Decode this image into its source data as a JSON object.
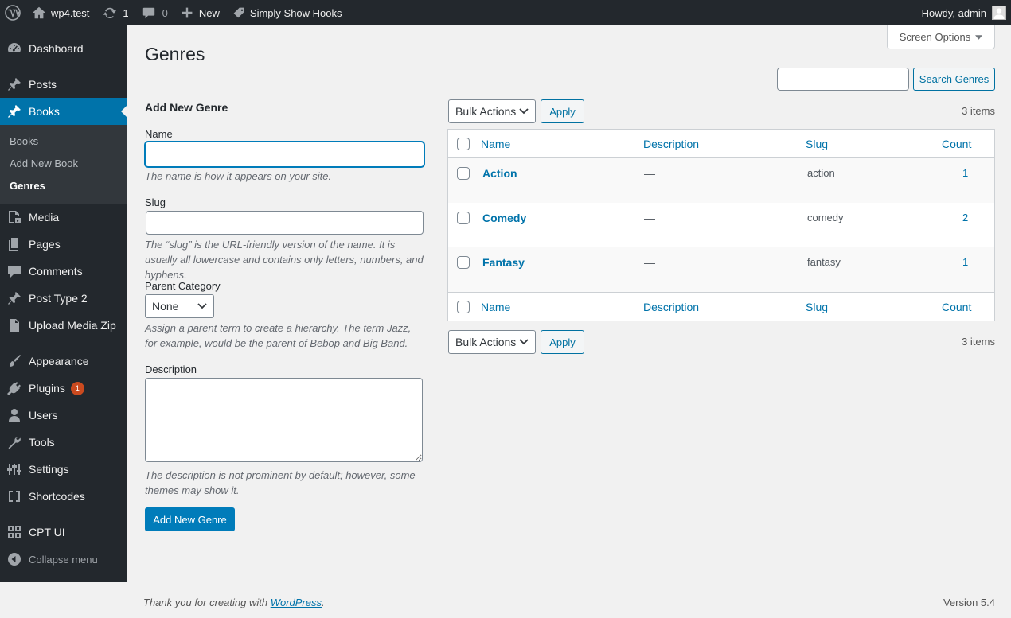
{
  "adminbar": {
    "site_name": "wp4.test",
    "updates_count": "1",
    "comments_count": "0",
    "new_label": "New",
    "plugin_link": "Simply Show Hooks",
    "howdy": "Howdy, admin"
  },
  "sidebar": {
    "items": [
      {
        "label": "Dashboard",
        "icon": "dashboard-icon"
      },
      {
        "label": "Posts",
        "icon": "pin-icon"
      },
      {
        "label": "Books",
        "icon": "pin-icon"
      },
      {
        "label": "Media",
        "icon": "media-icon"
      },
      {
        "label": "Pages",
        "icon": "pages-icon"
      },
      {
        "label": "Comments",
        "icon": "comment-icon"
      },
      {
        "label": "Post Type 2",
        "icon": "pin-icon"
      },
      {
        "label": "Upload Media Zip",
        "icon": "document-icon"
      },
      {
        "label": "Appearance",
        "icon": "brush-icon"
      },
      {
        "label": "Plugins",
        "icon": "plugin-icon",
        "badge": "1"
      },
      {
        "label": "Users",
        "icon": "user-icon"
      },
      {
        "label": "Tools",
        "icon": "wrench-icon"
      },
      {
        "label": "Settings",
        "icon": "settings-icon"
      },
      {
        "label": "Shortcodes",
        "icon": "brackets-icon"
      },
      {
        "label": "CPT UI",
        "icon": "grid-icon"
      }
    ],
    "submenu": [
      {
        "label": "Books"
      },
      {
        "label": "Add New Book"
      },
      {
        "label": "Genres"
      }
    ],
    "collapse_label": "Collapse menu"
  },
  "page": {
    "title": "Genres",
    "screen_options": "Screen Options",
    "search_value": "",
    "search_button": "Search Genres"
  },
  "form": {
    "heading": "Add New Genre",
    "name_label": "Name",
    "name_value": "",
    "name_help": "The name is how it appears on your site.",
    "slug_label": "Slug",
    "slug_value": "",
    "slug_help": "The “slug” is the URL-friendly version of the name. It is usually all lowercase and contains only letters, numbers, and hyphens.",
    "parent_label": "Parent Category",
    "parent_selected": "None",
    "parent_help": "Assign a parent term to create a hierarchy. The term Jazz, for example, would be the parent of Bebop and Big Band.",
    "description_label": "Description",
    "description_value": "",
    "description_help": "The description is not prominent by default; however, some themes may show it.",
    "submit_label": "Add New Genre"
  },
  "list": {
    "bulk_actions": "Bulk Actions",
    "apply_label": "Apply",
    "items_count": "3 items",
    "columns": {
      "name": "Name",
      "description": "Description",
      "slug": "Slug",
      "count": "Count"
    },
    "rows": [
      {
        "name": "Action",
        "description": "—",
        "slug": "action",
        "count": "1"
      },
      {
        "name": "Comedy",
        "description": "—",
        "slug": "comedy",
        "count": "2"
      },
      {
        "name": "Fantasy",
        "description": "—",
        "slug": "fantasy",
        "count": "1"
      }
    ]
  },
  "footer": {
    "thanks_prefix": "Thank you for creating with",
    "wordpress_link": "WordPress",
    "thanks_suffix": ".",
    "version": "Version 5.4"
  }
}
